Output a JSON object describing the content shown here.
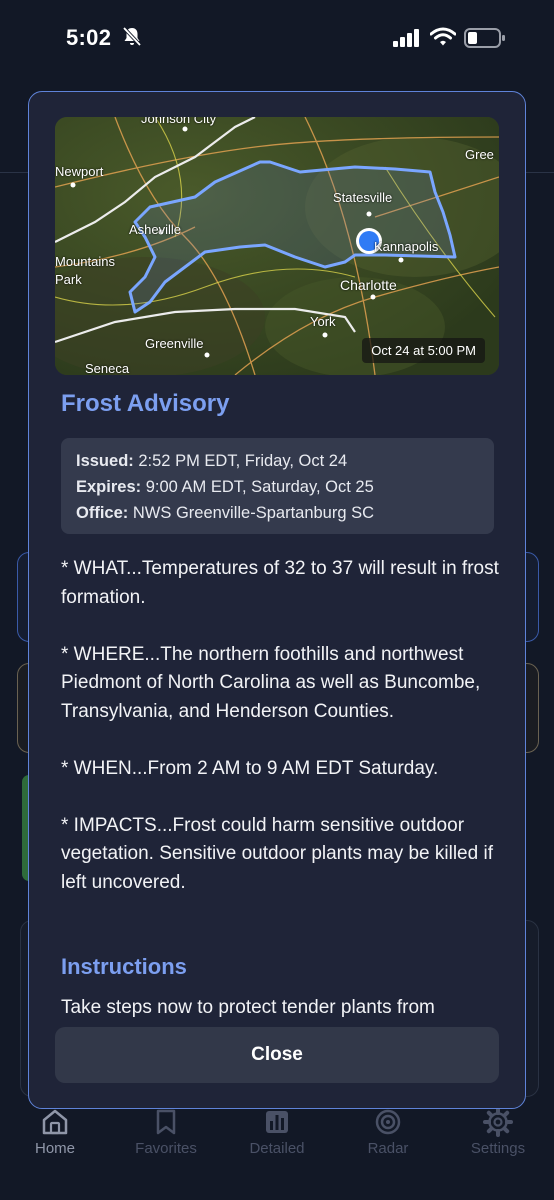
{
  "status_bar": {
    "time": "5:02"
  },
  "map": {
    "timestamp": "Oct 24 at 5:00 PM",
    "labels": {
      "johnson_city": "Johnson City",
      "newport": "Newport",
      "asheville": "Asheville",
      "mountains": "Mountains",
      "park": "Park",
      "statesville": "Statesville",
      "kannapolis": "Kannapolis",
      "charlotte": "Charlotte",
      "york": "York",
      "greenville": "Greenville",
      "seneca": "Seneca",
      "gree": "Gree"
    }
  },
  "alert": {
    "title": "Frost Advisory",
    "issued_label": "Issued:",
    "issued_value": "2:52 PM EDT, Friday, Oct 24",
    "expires_label": "Expires:",
    "expires_value": "9:00 AM EDT, Saturday, Oct 25",
    "office_label": "Office:",
    "office_value": "NWS Greenville-Spartanburg SC",
    "description": [
      "* WHAT...Temperatures of 32 to 37 will result in frost formation.",
      "* WHERE...The northern foothills and northwest Piedmont of North Carolina as well as Buncombe, Transylvania, and Henderson Counties.",
      "* WHEN...From 2 AM to 9 AM EDT Saturday.",
      "* IMPACTS...Frost could harm sensitive outdoor vegetation. Sensitive outdoor plants may be killed if left uncovered."
    ],
    "instructions_title": "Instructions",
    "instructions_text": "Take steps now to protect tender plants from"
  },
  "close_label": "Close",
  "tabs": [
    {
      "label": "Home",
      "icon": "home-icon"
    },
    {
      "label": "Favorites",
      "icon": "bookmark-icon"
    },
    {
      "label": "Detailed",
      "icon": "bar-chart-icon"
    },
    {
      "label": "Radar",
      "icon": "radar-icon"
    },
    {
      "label": "Settings",
      "icon": "gear-icon"
    }
  ],
  "colors": {
    "accent": "#7c9ff0",
    "modal_border": "#5f83d9",
    "location_dot": "#2f7bf5"
  }
}
